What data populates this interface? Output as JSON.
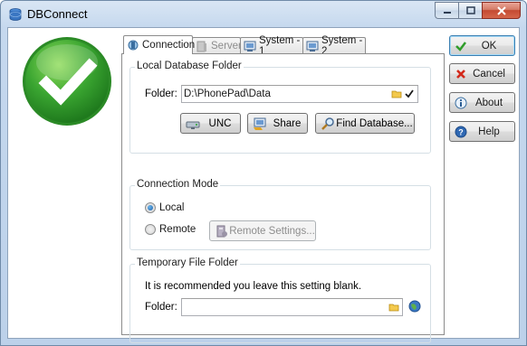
{
  "window": {
    "title": "DBConnect"
  },
  "tabs": [
    {
      "label": "Connection",
      "active": true
    },
    {
      "label": "Server",
      "disabled": true
    },
    {
      "label": "System - 1"
    },
    {
      "label": "System - 2"
    }
  ],
  "local_db": {
    "title": "Local Database Folder",
    "folder_label": "Folder:",
    "folder_value": "D:\\PhonePad\\Data",
    "buttons": {
      "unc": "UNC",
      "share": "Share",
      "find": "Find Database..."
    }
  },
  "connection_mode": {
    "title": "Connection Mode",
    "local_label": "Local",
    "remote_label": "Remote",
    "selected": "Local",
    "remote_settings_label": "Remote Settings..."
  },
  "temp_folder": {
    "title": "Temporary File Folder",
    "note": "It is recommended you leave this setting blank.",
    "folder_label": "Folder:",
    "folder_value": ""
  },
  "side_buttons": {
    "ok": "OK",
    "cancel": "Cancel",
    "about": "About",
    "help": "Help"
  },
  "colors": {
    "check_green": "#3aa531",
    "accent_blue": "#3c7fb1"
  }
}
